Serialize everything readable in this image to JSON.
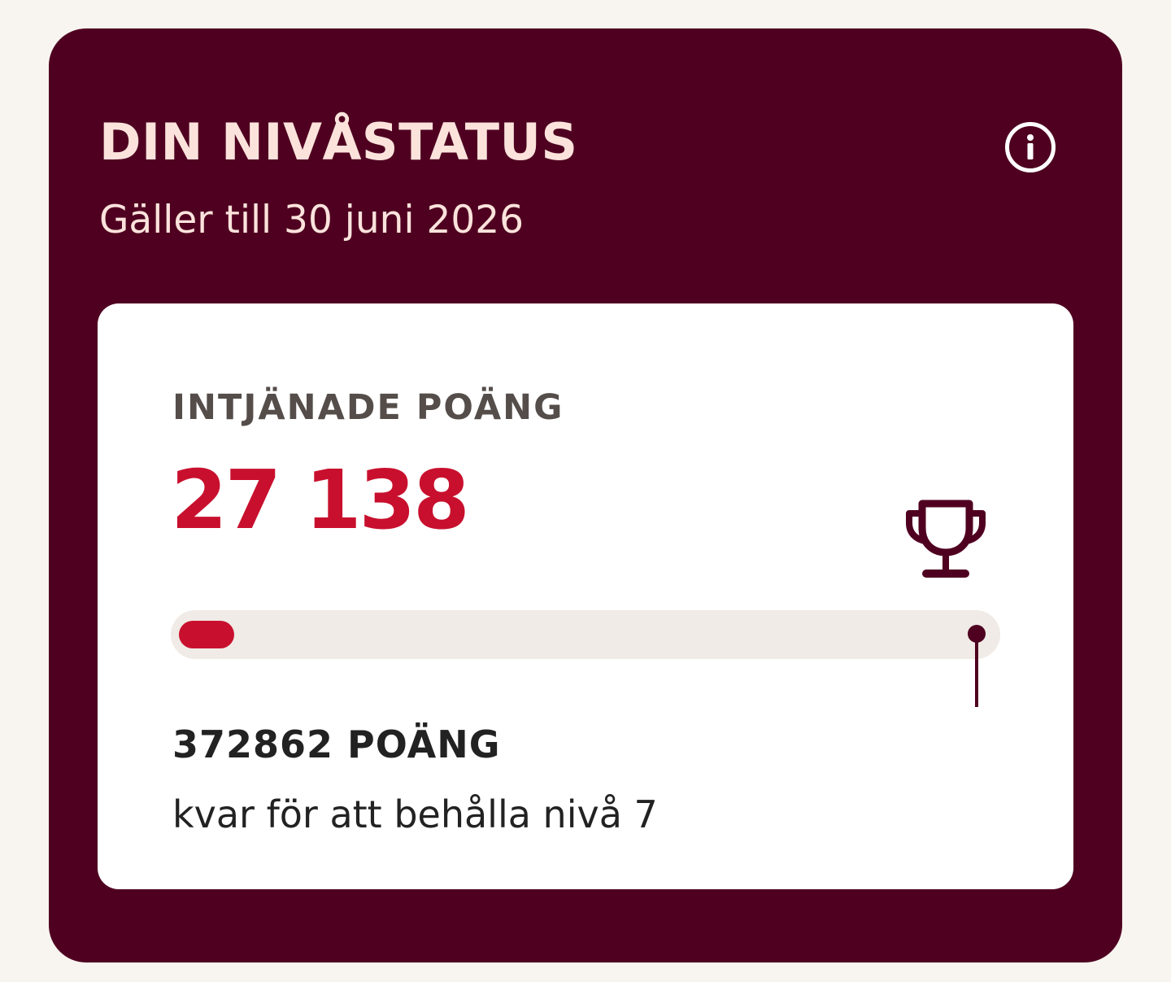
{
  "level_status": {
    "title": "DIN NIVÅSTATUS",
    "validity": "Gäller till 30 juni 2026",
    "info_icon": "info-icon"
  },
  "points": {
    "label": "INTJÄNADE POÄNG",
    "value": "27 138",
    "icon": "trophy-icon",
    "progress_fraction": 0.068,
    "remaining": "372862 POÄNG",
    "remaining_text": "kvar för att behålla nivå 7"
  },
  "colors": {
    "card_background": "#4f0020",
    "header_text": "#fbe3dc",
    "accent_red": "#c8102e",
    "track": "#f0ebe6",
    "label_gray": "#544d4a",
    "page_background": "#f8f5f0"
  }
}
